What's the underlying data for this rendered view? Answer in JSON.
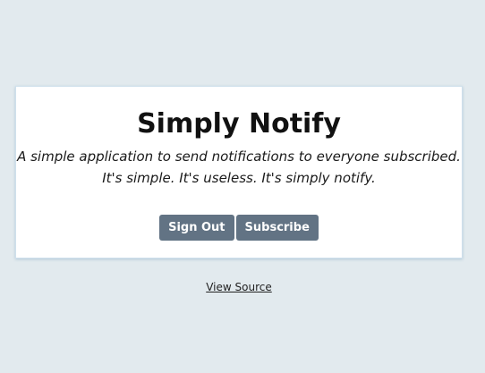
{
  "card": {
    "title": "Simply Notify",
    "subtitle_line1": "A simple application to send notifications to everyone subscribed.",
    "subtitle_line2": "It's simple. It's useless. It's simply notify."
  },
  "actions": {
    "sign_out_label": "Sign Out",
    "subscribe_label": "Subscribe"
  },
  "footer": {
    "view_source_label": "View Source"
  },
  "colors": {
    "background": "#e2eaee",
    "card": "#ffffff",
    "button": "#627384",
    "button_text": "#ffffff"
  }
}
